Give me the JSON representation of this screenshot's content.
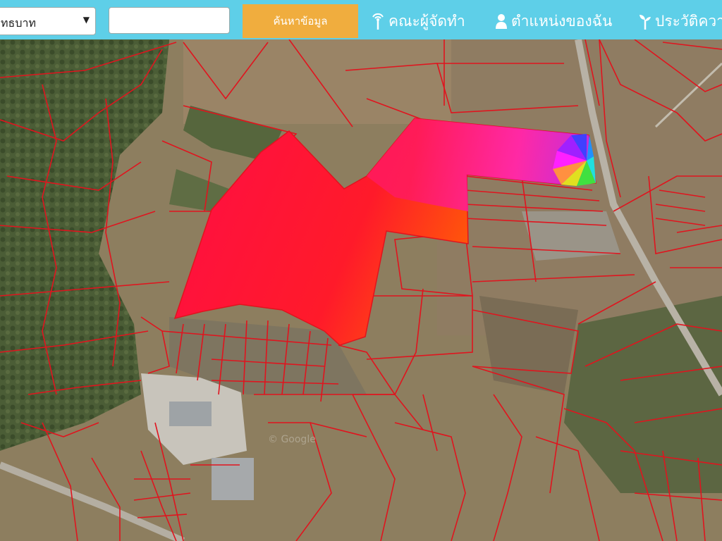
{
  "province_select": {
    "value": "ุทธบาท"
  },
  "search": {
    "value": "",
    "button_label": "ค้นหาข้อมูล"
  },
  "nav": {
    "team": "คณะผู้จัดทำ",
    "my_location": "ตำแหน่งของฉัน",
    "history": "ประวัติควา"
  },
  "map": {
    "watermark": "© Google",
    "colors": {
      "parcel_line": "#e0141e",
      "highlight_start": "#ff1a3c",
      "highlight_end": "#ff5a00"
    }
  }
}
